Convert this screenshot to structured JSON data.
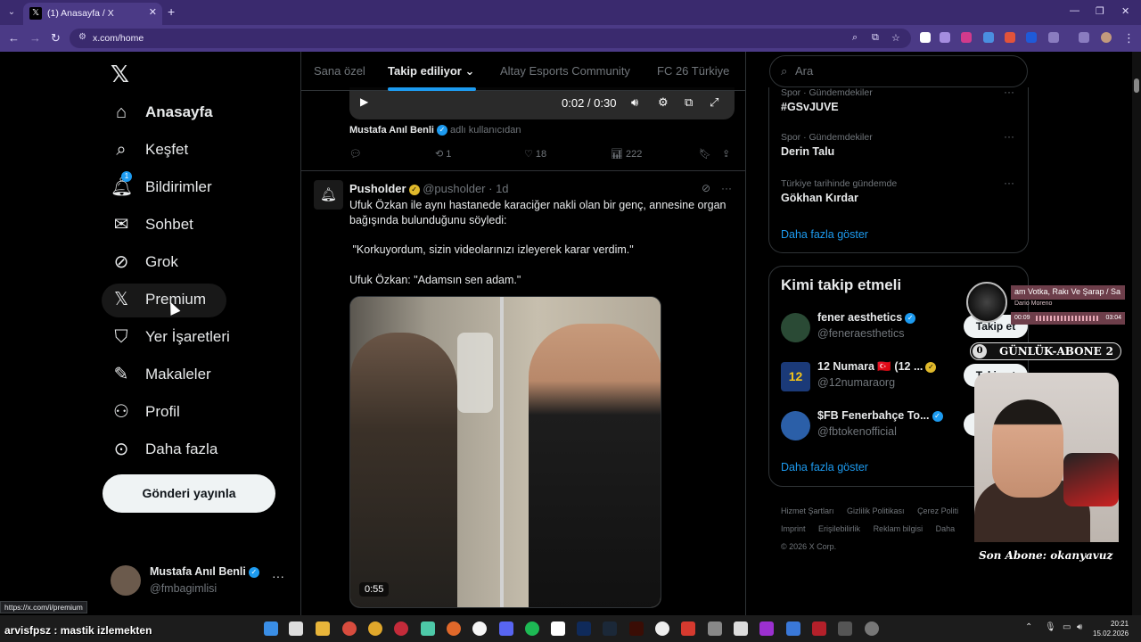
{
  "browser": {
    "tab_title": "(1) Anasayfa / X",
    "tab_favicon": "𝕏",
    "url": "x.com/home",
    "status_url": "https://x.com/i/premium"
  },
  "sidebar": {
    "logo": "𝕏",
    "items": [
      {
        "label": "Anasayfa",
        "icon": "home-icon",
        "glyph": "⌂"
      },
      {
        "label": "Keşfet",
        "icon": "search-icon",
        "glyph": "⌕"
      },
      {
        "label": "Bildirimler",
        "icon": "bell-icon",
        "glyph": "🔔︎",
        "badge": "1"
      },
      {
        "label": "Sohbet",
        "icon": "mail-icon",
        "glyph": "✉"
      },
      {
        "label": "Grok",
        "icon": "grok-icon",
        "glyph": "⊘"
      },
      {
        "label": "Premium",
        "icon": "x-logo-icon",
        "glyph": "𝕏"
      },
      {
        "label": "Yer İşaretleri",
        "icon": "bookmark-icon",
        "glyph": "⛉"
      },
      {
        "label": "Makaleler",
        "icon": "article-icon",
        "glyph": "✎"
      },
      {
        "label": "Profil",
        "icon": "profile-icon",
        "glyph": "⚇"
      },
      {
        "label": "Daha fazla",
        "icon": "more-circle-icon",
        "glyph": "⊙"
      }
    ],
    "post_button": "Gönderi yayınla",
    "account": {
      "name": "Mustafa Anıl Benli",
      "handle": "@fmbagimlisi",
      "more": "···"
    }
  },
  "main": {
    "tabs": [
      "Sana özel",
      "Takip ediliyor",
      "Altay Esports Community",
      "FC 26 Türkiye"
    ],
    "video": {
      "time": "0:02 / 0:30"
    },
    "tweet1": {
      "author": "Mustafa Anıl Benli",
      "suffix": "adlı kullanıcıdan",
      "replies": "",
      "retweets": "1",
      "likes": "18",
      "views": "222"
    },
    "tweet2": {
      "name": "Pusholder",
      "handle": "@pusholder",
      "time": "· 1d",
      "line1": "Ufuk Özkan ile aynı hastanede karaciğer nakli olan bir genç, annesine organ bağışında bulunduğunu söyledi:",
      "line2": " \"Korkuyordum, sizin videolarınızı izleyerek karar verdim.\"",
      "line3": "Ufuk Özkan: \"Adamsın sen adam.\"",
      "video_duration": "0:55"
    }
  },
  "right": {
    "search_placeholder": "Ara",
    "trends": [
      {
        "category": "Spor · Gündemdekiler",
        "name": "#GSvJUVE"
      },
      {
        "category": "Spor · Gündemdekiler",
        "name": "Derin Talu"
      },
      {
        "category": "Türkiye tarihinde gündemde",
        "name": "Gökhan Kırdar"
      }
    ],
    "show_more": "Daha fazla göster",
    "who_title": "Kimi takip etmeli",
    "who": [
      {
        "name": "fener aesthetics",
        "handle": "@feneraesthetics",
        "color": "#2a4a35"
      },
      {
        "name": "12 Numara 🇹🇷 (12 ...",
        "handle": "@12numaraorg",
        "color": "#1b3a78"
      },
      {
        "name": "$FB Fenerbahçe To...",
        "handle": "@fbtokenofficial",
        "color": "#2b5fa8"
      }
    ],
    "follow_label": "Takip et",
    "footer": [
      "Hizmet Şartları",
      "Gizlilik Politikası",
      "Çerez Politi",
      "Imprint",
      "Erişilebilirlik",
      "Reklam bilgisi",
      "Daha",
      "© 2026 X Corp."
    ]
  },
  "overlay": {
    "np_title": "am Votka, Rakı Ve Şarap / Sa",
    "np_artist": "Dario Moreno",
    "np_start": "00:09",
    "np_end": "03:04",
    "sub_zero": "0",
    "sub_label": "GÜNLÜK-ABONE",
    "sub_count": "2",
    "son_abone": "Son Abone: okanyavuz",
    "chat": "arvisfpsz : mastik izlemekten"
  },
  "taskbar": {
    "time": "20:21",
    "date": "15.02.2026"
  }
}
